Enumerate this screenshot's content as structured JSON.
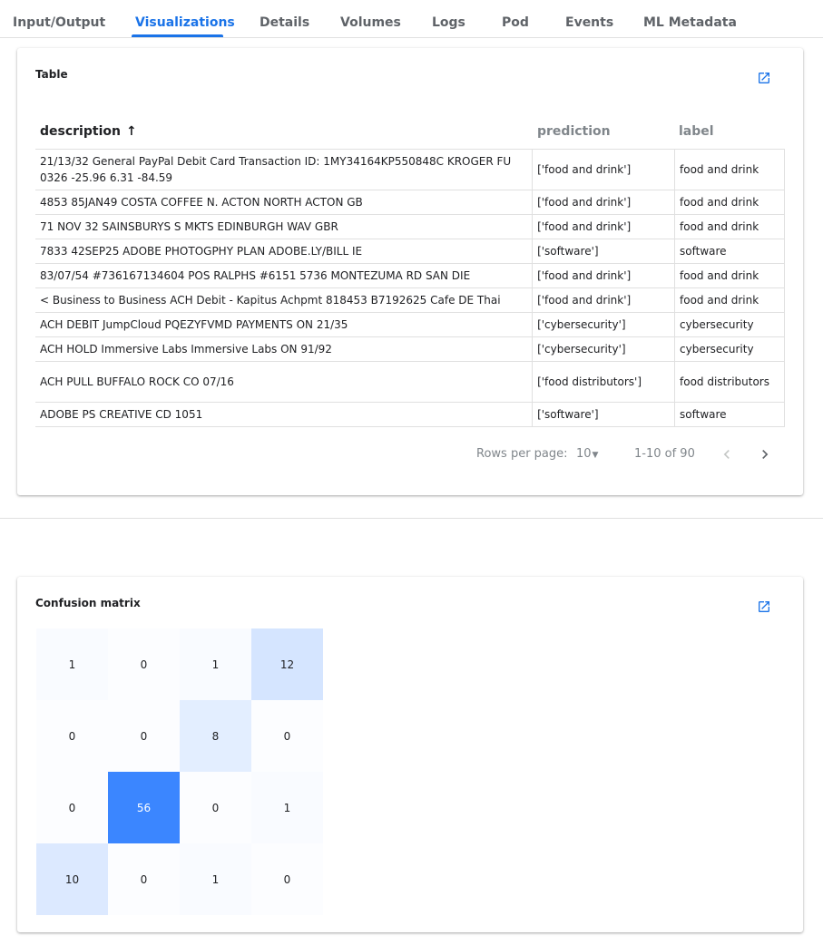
{
  "tabs": [
    {
      "label": "Input/Output",
      "active": false
    },
    {
      "label": "Visualizations",
      "active": true
    },
    {
      "label": "Details",
      "active": false
    },
    {
      "label": "Volumes",
      "active": false
    },
    {
      "label": "Logs",
      "active": false
    },
    {
      "label": "Pod",
      "active": false
    },
    {
      "label": "Events",
      "active": false
    },
    {
      "label": "ML Metadata",
      "active": false
    }
  ],
  "table_card": {
    "title": "Table",
    "columns": {
      "description": "description",
      "prediction": "prediction",
      "label": "label"
    },
    "sort_icon": "arrow-up-icon",
    "rows": [
      {
        "description": "21/13/32 General PayPal Debit Card Transaction ID: 1MY34164KP550848C KROGER FU 0326 -25.96 6.31 -84.59",
        "prediction": "['food and drink']",
        "label": "food and drink"
      },
      {
        "description": "4853 85JAN49 COSTA COFFEE N. ACTON NORTH ACTON GB",
        "prediction": "['food and drink']",
        "label": "food and drink"
      },
      {
        "description": "71 NOV 32 SAINSBURYS S MKTS EDINBURGH WAV GBR",
        "prediction": "['food and drink']",
        "label": "food and drink"
      },
      {
        "description": "7833 42SEP25 ADOBE PHOTOGPHY PLAN ADOBE.LY/BILL IE",
        "prediction": "['software']",
        "label": "software"
      },
      {
        "description": "83/07/54 #736167134604 POS RALPHS #6151 5736 MONTEZUMA RD SAN DIE",
        "prediction": "['food and drink']",
        "label": "food and drink"
      },
      {
        "description": "< Business to Business ACH Debit - Kapitus Achpmt 818453 B7192625 Cafe DE Thai",
        "prediction": "['food and drink']",
        "label": "food and drink"
      },
      {
        "description": "ACH DEBIT JumpCloud PQEZYFVMD PAYMENTS ON 21/35",
        "prediction": "['cybersecurity']",
        "label": "cybersecurity"
      },
      {
        "description": "ACH HOLD Immersive Labs Immersive Labs ON 91/92",
        "prediction": "['cybersecurity']",
        "label": "cybersecurity"
      },
      {
        "description": "ACH PULL BUFFALO ROCK CO 07/16",
        "prediction": "['food distributors']",
        "label": "food distributors"
      },
      {
        "description": "ADOBE PS CREATIVE CD 1051",
        "prediction": "['software']",
        "label": "software"
      }
    ],
    "pagination": {
      "rows_per_page_label": "Rows per page:",
      "rows_per_page_value": "10",
      "range": "1-10 of 90"
    }
  },
  "confusion_card": {
    "title": "Confusion matrix",
    "chart_data": {
      "type": "heatmap",
      "title": "Confusion matrix",
      "values": [
        [
          1,
          0,
          1,
          12
        ],
        [
          0,
          0,
          8,
          0
        ],
        [
          0,
          56,
          0,
          1
        ],
        [
          10,
          0,
          1,
          0
        ]
      ],
      "max_color": "#3b86ff"
    }
  },
  "colors": {
    "accent": "#1a73e8",
    "muted_text": "#80868b",
    "heat_max": "#3b86ff"
  }
}
